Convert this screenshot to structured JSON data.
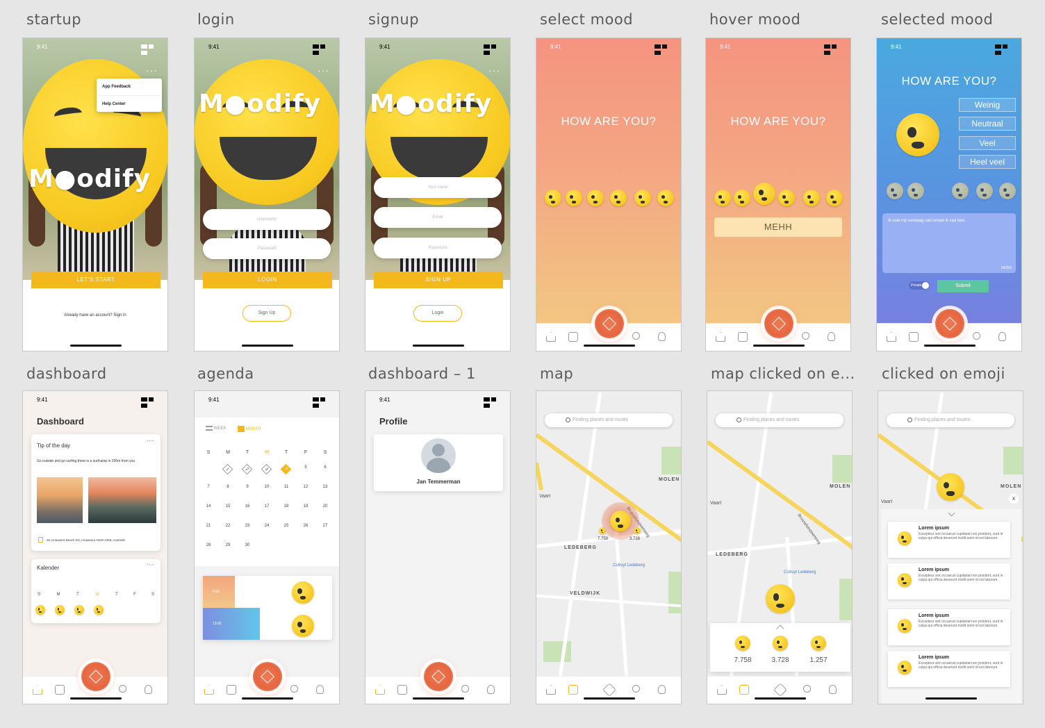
{
  "boards": [
    {
      "label": "startup"
    },
    {
      "label": "login"
    },
    {
      "label": "signup"
    },
    {
      "label": "select mood"
    },
    {
      "label": "hover mood"
    },
    {
      "label": "selected mood"
    },
    {
      "label": "dashboard"
    },
    {
      "label": "agenda"
    },
    {
      "label": "dashboard – 1"
    },
    {
      "label": "map"
    },
    {
      "label": "map clicked on e..."
    },
    {
      "label": "clicked on emoji"
    }
  ],
  "status": {
    "time": "9:41"
  },
  "app": {
    "logo_pre": "M",
    "logo_post": "odify"
  },
  "startup": {
    "menu": [
      "App Feedback",
      "Help Center"
    ],
    "cta": "LET'S START",
    "signin": "Already have an account? Sign in"
  },
  "login": {
    "username": "Username",
    "password": "Password",
    "cta": "LOGIN",
    "signup": "Sign Up"
  },
  "signup": {
    "name": "Your name",
    "email": "Email",
    "password": "Password",
    "cta": "SIGN UP",
    "login": "Login"
  },
  "mood": {
    "question": "HOW ARE YOU?",
    "hover": "MEHH",
    "options": [
      "Weinig",
      "Neutraal",
      "Veel",
      "Heel veel"
    ],
    "note": "Ik voel mij vandaag sad omdat ik sad ben.",
    "count": "24/250",
    "private": "Private",
    "submit": "Submit"
  },
  "dashboard": {
    "title": "Dashboard",
    "tip_title": "Tip of the day",
    "tip_text": "Go outside and go surfing,there is a surfcamp in 200m from you",
    "address": "46 Amawarra Beach Rd, Amawarra NSW 2456, Australië",
    "kal_title": "Kalender",
    "days": [
      "S",
      "M",
      "T",
      "W",
      "T",
      "F",
      "S"
    ]
  },
  "agenda": {
    "week": "WEEK",
    "month": "MONTH",
    "days": [
      "S",
      "M",
      "T",
      "W",
      "T",
      "F",
      "S"
    ],
    "dates": [
      "1",
      "2",
      "3",
      "4",
      "5",
      "6",
      "7",
      "8",
      "9",
      "10",
      "11",
      "12",
      "13",
      "14",
      "15",
      "16",
      "17",
      "18",
      "19",
      "20",
      "21",
      "22",
      "23",
      "24",
      "25",
      "26",
      "27",
      "28",
      "29",
      "30"
    ],
    "slots": [
      "8:00",
      "13:00"
    ]
  },
  "profile": {
    "title": "Profile",
    "name": "Jan Temmerman"
  },
  "map": {
    "search": "Finding places and routes",
    "ledeberg": "LEDEBERG",
    "veldwijk": "VELDWIJK",
    "molen": "MOLEN",
    "colruyt": "Colruyt Ledeberg",
    "vaart": "Vaart",
    "street": "Brusselsesteenweg",
    "counts": [
      "7.758",
      "3.728",
      "1.257"
    ]
  },
  "list": {
    "items": [
      {
        "title": "Lorem ipsum",
        "text": "Excepteur sint occaecat cupidatat non proident, sunt in culpa qui officia deserunt mollit anim id est laborum."
      },
      {
        "title": "Lorem ipsum",
        "text": "Excepteur sint occaecat cupidatat non proident, sunt in culpa qui officia deserunt mollit anim id est laborum."
      },
      {
        "title": "Lorem ipsum",
        "text": "Excepteur sint occaecat cupidatat non proident, sunt in culpa qui officia deserunt mollit anim id est laborum."
      },
      {
        "title": "Lorem ipsum",
        "text": "Excepteur sint occaecat cupidatat non proident, sunt in culpa qui officia deserunt mollit anim id est laborum."
      }
    ]
  }
}
